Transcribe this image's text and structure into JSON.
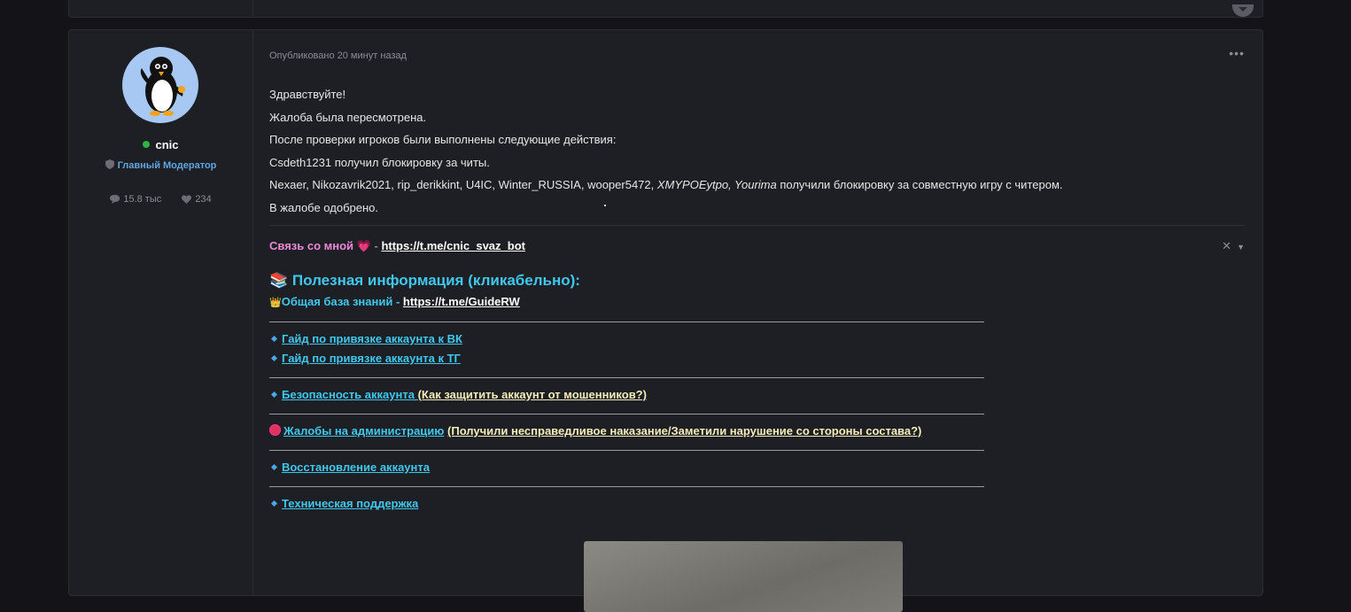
{
  "post": {
    "author": {
      "username": "cnic",
      "role": "Главный Модератор",
      "posts_count": "15.8 тыс",
      "reactions_count": "234"
    },
    "meta": "Опубликовано 20 минут назад",
    "more_label": "•••",
    "body": {
      "line1": "Здравствуйте!",
      "line2": "Жалоба была пересмотрена.",
      "line3": "После проверки игроков были выполнены следующие действия:",
      "line4": "Csdeth1231 получил блокировку за читы.",
      "line5_prefix": "Nexaer, Nikozavrik2021, rip_derikkint, U4IC, Winter_RUSSIA, wooper5472, ",
      "line5_italic": "XMYPOEytpo, Yourima",
      "line5_suffix": " получили блокировку за совместную игру с читером.",
      "line6": "В жалобе одобрено."
    }
  },
  "signature": {
    "contact_label": "Связь со мной",
    "heart": "💗",
    "separator": " - ",
    "contact_link": "https://t.me/cnic_svaz_bot",
    "close_symbol": "✕",
    "info_icon": "📚",
    "info_title": "Полезная информация (кликабельно):",
    "kb_icon": "👑",
    "kb_label": "Общая база знаний - ",
    "kb_link": "https://t.me/GuideRW",
    "guide_vk": "Гайд по привязке аккаунта к ВК",
    "guide_tg": "Гайд по привязке аккаунта к ТГ",
    "security_label": "Безопасность аккаунта ",
    "security_note": "(Как защитить аккаунт от мошенников?)",
    "complaints_label": "Жалобы на администрацию",
    "complaints_note": "(Получили несправедливое наказание/Заметили нарушение со стороны состава?)",
    "recovery_label": "Восстановление аккаунта",
    "support_label": "Техническая поддержка"
  },
  "colors": {
    "accent_cyan": "#3fc8ee",
    "accent_pink": "#ee88d8",
    "online": "#2fb344",
    "role": "#5ea6e0"
  }
}
